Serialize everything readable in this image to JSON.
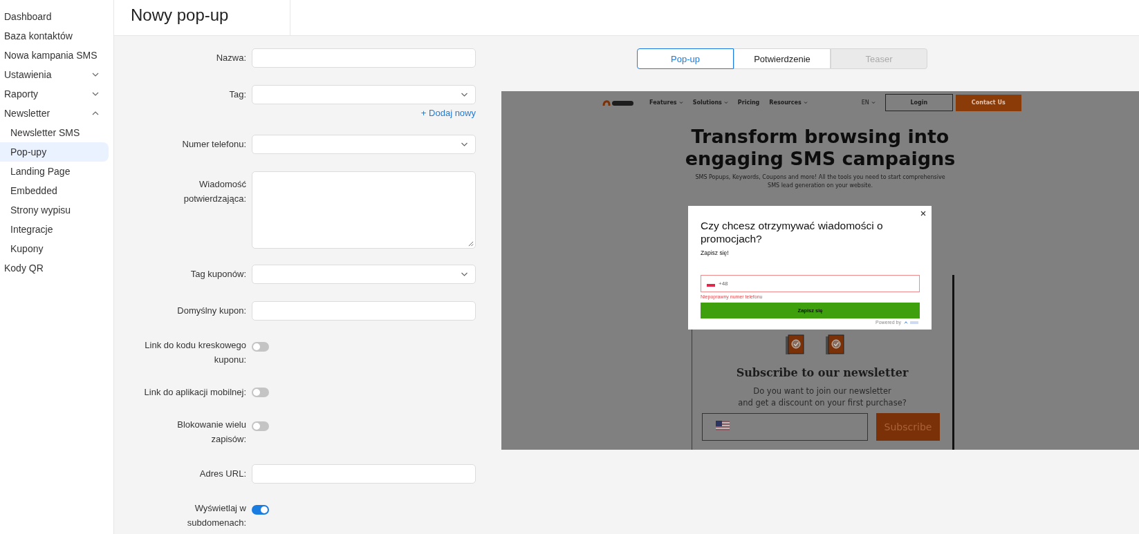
{
  "sidebar": {
    "items": [
      {
        "label": "Dashboard",
        "selected": false
      },
      {
        "label": "Baza kontaktów",
        "selected": false
      },
      {
        "label": "Nowa kampania SMS",
        "selected": false
      },
      {
        "label": "Ustawienia",
        "selected": false,
        "expanded": false
      },
      {
        "label": "Raporty",
        "selected": false,
        "expanded": false
      },
      {
        "label": "Newsletter",
        "selected": false,
        "expanded": true,
        "children": [
          {
            "label": "Newsletter SMS",
            "selected": false
          },
          {
            "label": "Pop-upy",
            "selected": true
          },
          {
            "label": "Landing Page",
            "selected": false
          },
          {
            "label": "Embedded",
            "selected": false
          },
          {
            "label": "Strony wypisu",
            "selected": false
          },
          {
            "label": "Integracje",
            "selected": false
          },
          {
            "label": "Kupony",
            "selected": false
          }
        ]
      },
      {
        "label": "Kody QR",
        "selected": false
      }
    ]
  },
  "header": {
    "title": "Nowy pop-up"
  },
  "form": {
    "fields": [
      {
        "kind": "text",
        "label": "Nazwa:"
      },
      {
        "kind": "select",
        "label": "Tag:",
        "link": "+ Dodaj nowy"
      },
      {
        "kind": "select",
        "label": "Numer telefonu:"
      },
      {
        "kind": "textarea",
        "label": "Wiadomość\npotwierdzająca:"
      },
      {
        "kind": "select",
        "label": "Tag kuponów:"
      },
      {
        "kind": "text",
        "label": "Domyślny kupon:"
      },
      {
        "kind": "toggle",
        "label": "Link do kodu kreskowego\nkuponu:",
        "on": false
      },
      {
        "kind": "toggle",
        "label": "Link do aplikacji mobilnej:",
        "on": false
      },
      {
        "kind": "toggle",
        "label": "Blokowanie wielu\nzapisów:",
        "on": false
      },
      {
        "kind": "text",
        "label": "Adres URL:"
      },
      {
        "kind": "toggle",
        "label": "Wyświetlaj w\nsubdomenach:",
        "on": true
      }
    ]
  },
  "preview_tabs": [
    {
      "label": "Pop-up",
      "selected": true,
      "disabled": false
    },
    {
      "label": "Potwierdzenie",
      "selected": false,
      "disabled": false
    },
    {
      "label": "Teaser",
      "selected": false,
      "disabled": true
    }
  ],
  "preview": {
    "nav": [
      {
        "label": "Features",
        "caret": true
      },
      {
        "label": "Solutions",
        "caret": true
      },
      {
        "label": "Pricing",
        "caret": false
      },
      {
        "label": "Resources",
        "caret": true
      }
    ],
    "language": "EN",
    "login": "Login",
    "contact": "Contact Us",
    "headline": "Transform browsing into\nengaging SMS campaigns",
    "subtitle": "SMS Popups, Keywords, Coupons and more! All the tools you need to start comprehensive\nSMS lead generation on your website.",
    "popup": {
      "title": "Czy chcesz otrzymywać wiadomości o promocjach?",
      "text": "Zapisz się!",
      "prefix": "+48",
      "error": "Niepoprawny numer telefonu",
      "button": "Zapisz się",
      "powered": "Powered by"
    },
    "newsletter": {
      "title": "Subscribe to our newsletter",
      "text": "Do you want to join our newsletter\nand get a discount on your first purchase?",
      "button": "Subscribe"
    }
  }
}
